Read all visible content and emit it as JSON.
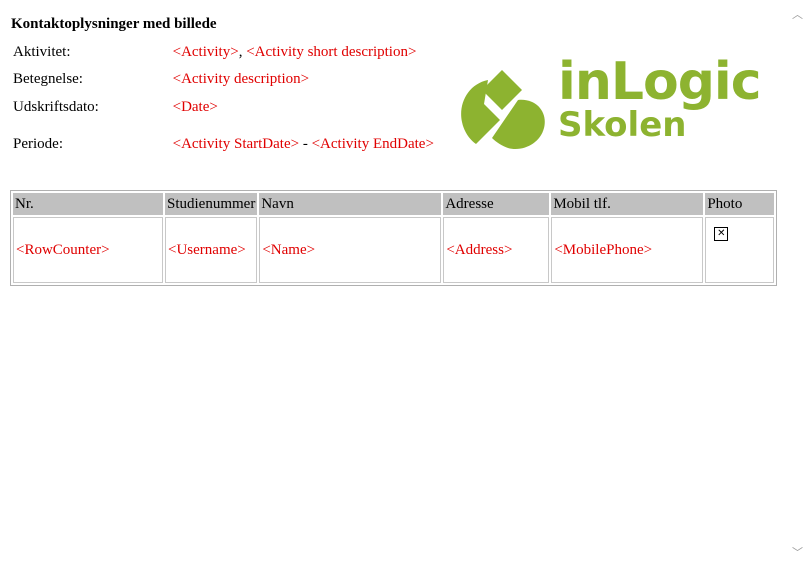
{
  "title": "Kontaktoplysninger med billede",
  "info": {
    "aktivitet_label": "Aktivitet:",
    "aktivitet_value1": "<Activity>",
    "aktivitet_sep": ", ",
    "aktivitet_value2": "<Activity short description>",
    "betegnelse_label": "Betegnelse:",
    "betegnelse_value": "<Activity description>",
    "udskriftsdato_label": "Udskriftsdato:",
    "udskriftsdato_value": "<Date>",
    "periode_label": "Periode:",
    "periode_start": "<Activity StartDate>",
    "periode_sep": " - ",
    "periode_end": "<Activity EndDate>"
  },
  "logo": {
    "line1": "inLogic",
    "line2": "Skolen",
    "color": "#8db330"
  },
  "table": {
    "headers": [
      "Nr.",
      "Studienummer",
      "Navn",
      "Adresse",
      "Mobil tlf.",
      "Photo"
    ],
    "row": [
      "<RowCounter>",
      "<Username>",
      "<Name>",
      "<Address>",
      "<MobilePhone>"
    ],
    "photo_icon": "broken-image-icon"
  },
  "colors": {
    "placeholder_text": "#e00000",
    "header_bg": "#c0c0c0"
  }
}
